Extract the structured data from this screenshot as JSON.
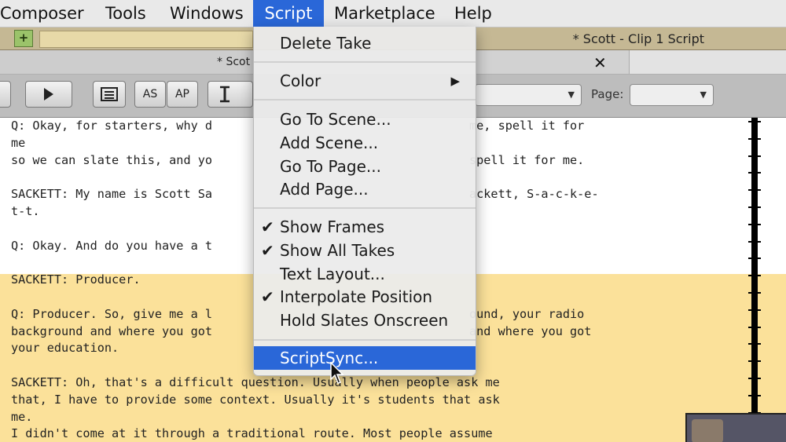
{
  "menubar": {
    "items": [
      "Composer",
      "Tools",
      "Windows",
      "Script",
      "Marketplace",
      "Help"
    ],
    "active": "Script"
  },
  "binbar": {
    "title": "* Scott - Clip 1 Script"
  },
  "window": {
    "tab_title": "* Scot",
    "close": "✕"
  },
  "toolbar": {
    "as_label": "AS",
    "ap_label": "AP",
    "page_label": "Page:",
    "page_value": ""
  },
  "script_menu": {
    "delete_take": "Delete Take",
    "color": "Color",
    "go_to_scene": "Go To Scene...",
    "add_scene": "Add Scene...",
    "go_to_page": "Go To Page...",
    "add_page": "Add Page...",
    "show_frames": "Show Frames",
    "show_all_takes": "Show All Takes",
    "text_layout": "Text Layout...",
    "interpolate_position": "Interpolate Position",
    "hold_slates": "Hold Slates Onscreen",
    "scriptsync": "ScriptSync...",
    "checked": [
      "Show Frames",
      "Show All Takes",
      "Interpolate Position"
    ],
    "highlighted": "ScriptSync..."
  },
  "script_text": [
    "Q: Okay, for starters, why d",
    "me",
    "so we can slate this, and yo",
    "",
    "SACKETT: My name is Scott Sa",
    "t-t.",
    "",
    "Q: Okay. And do you have a t",
    "",
    "SACKETT: Producer.",
    "",
    "Q: Producer. So, give me a l",
    "background and where you got",
    "your education.",
    "",
    "SACKETT: Oh, that's a difficult question. Usually when people ask me",
    "that, I have to provide some context. Usually it's students that ask",
    "me.",
    "I didn't come at it through a traditional route. Most people assume"
  ],
  "script_text_right": {
    "line0": "me, spell it for",
    "line2": "spell it for me.",
    "line4": "ackett, S-a-c-k-e-",
    "line11": "ound, your radio",
    "line12": "and where you got"
  },
  "colors": {
    "menu_highlight": "#2a67d8",
    "script_highlight": "#fbe19a"
  }
}
